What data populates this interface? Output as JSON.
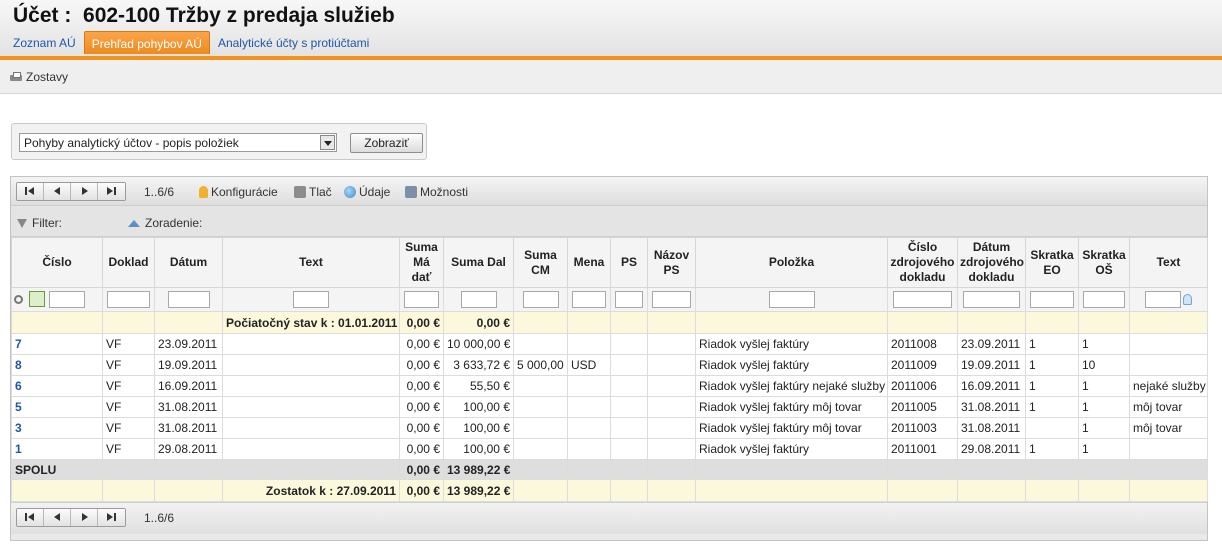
{
  "header": {
    "title": "Účet :  602-100 Tržby z predaja služieb",
    "tabs": [
      {
        "label": "Zoznam AÚ",
        "active": false
      },
      {
        "label": "Prehľad pohybov AÚ",
        "active": true
      },
      {
        "label": "Analytické účty s protiúčtami",
        "active": false
      }
    ]
  },
  "subbar": {
    "zostavy_label": "Zostavy"
  },
  "report_select": {
    "selected": "Pohyby analytický účtov - popis položiek",
    "button_label": "Zobraziť"
  },
  "toolbar": {
    "page_info": "1..6/6",
    "konfiguracie": "Konfigurácie",
    "tlac": "Tlač",
    "udaje": "Údaje",
    "moznosti": "Možnosti"
  },
  "filterbar": {
    "filter_label": "Filter:",
    "sort_label": "Zoradenie:"
  },
  "columns": [
    "Číslo",
    "Doklad",
    "Dátum",
    "Text",
    "Suma Má dať",
    "Suma Dal",
    "Suma CM",
    "Mena",
    "PS",
    "Názov PS",
    "Položka",
    "Číslo zdrojového dokladu",
    "Dátum zdrojového dokladu",
    "Skratka EO",
    "Skratka OŠ",
    "Text"
  ],
  "opening": {
    "label": "Počiatočný stav k : 01.01.2011",
    "ma_dat": "0,00 €",
    "dal": "0,00 €"
  },
  "rows": [
    {
      "cislo": "7",
      "doklad": "VF",
      "datum": "23.09.2011",
      "text": "",
      "ma_dat": "0,00 €",
      "dal": "10 000,00 €",
      "cm": "",
      "mena": "",
      "ps": "",
      "nazov_ps": "",
      "polozka": "Riadok vyšlej faktúry",
      "cislo_zd": "2011008",
      "datum_zd": "23.09.2011",
      "eo": "1",
      "os": "1",
      "text2": ""
    },
    {
      "cislo": "8",
      "doklad": "VF",
      "datum": "19.09.2011",
      "text": "",
      "ma_dat": "0,00 €",
      "dal": "3 633,72 €",
      "cm": "5 000,00",
      "mena": "USD",
      "ps": "",
      "nazov_ps": "",
      "polozka": "Riadok vyšlej faktúry",
      "cislo_zd": "2011009",
      "datum_zd": "19.09.2011",
      "eo": "1",
      "os": "10",
      "text2": ""
    },
    {
      "cislo": "6",
      "doklad": "VF",
      "datum": "16.09.2011",
      "text": "",
      "ma_dat": "0,00 €",
      "dal": "55,50 €",
      "cm": "",
      "mena": "",
      "ps": "",
      "nazov_ps": "",
      "polozka": "Riadok vyšlej faktúry nejaké služby",
      "cislo_zd": "2011006",
      "datum_zd": "16.09.2011",
      "eo": "1",
      "os": "1",
      "text2": "nejaké služby"
    },
    {
      "cislo": "5",
      "doklad": "VF",
      "datum": "31.08.2011",
      "text": "",
      "ma_dat": "0,00 €",
      "dal": "100,00 €",
      "cm": "",
      "mena": "",
      "ps": "",
      "nazov_ps": "",
      "polozka": "Riadok vyšlej faktúry môj tovar",
      "cislo_zd": "2011005",
      "datum_zd": "31.08.2011",
      "eo": "1",
      "os": "1",
      "text2": "môj tovar"
    },
    {
      "cislo": "3",
      "doklad": "VF",
      "datum": "31.08.2011",
      "text": "",
      "ma_dat": "0,00 €",
      "dal": "100,00 €",
      "cm": "",
      "mena": "",
      "ps": "",
      "nazov_ps": "",
      "polozka": "Riadok vyšlej faktúry môj tovar",
      "cislo_zd": "2011003",
      "datum_zd": "31.08.2011",
      "eo": "",
      "os": "1",
      "text2": "môj tovar"
    },
    {
      "cislo": "1",
      "doklad": "VF",
      "datum": "29.08.2011",
      "text": "",
      "ma_dat": "0,00 €",
      "dal": "100,00 €",
      "cm": "",
      "mena": "",
      "ps": "",
      "nazov_ps": "",
      "polozka": "Riadok vyšlej faktúry",
      "cislo_zd": "2011001",
      "datum_zd": "29.08.2011",
      "eo": "1",
      "os": "1",
      "text2": ""
    }
  ],
  "total": {
    "label": "SPOLU",
    "ma_dat": "0,00 €",
    "dal": "13 989,22 €"
  },
  "closing": {
    "label": "Zostatok k : 27.09.2011",
    "ma_dat": "0,00 €",
    "dal": "13 989,22 €"
  },
  "footer": {
    "page_info": "1..6/6"
  },
  "colors": {
    "accent": "#f5921e",
    "link": "#1f56a8",
    "highlight_row": "#fbf8dc"
  }
}
